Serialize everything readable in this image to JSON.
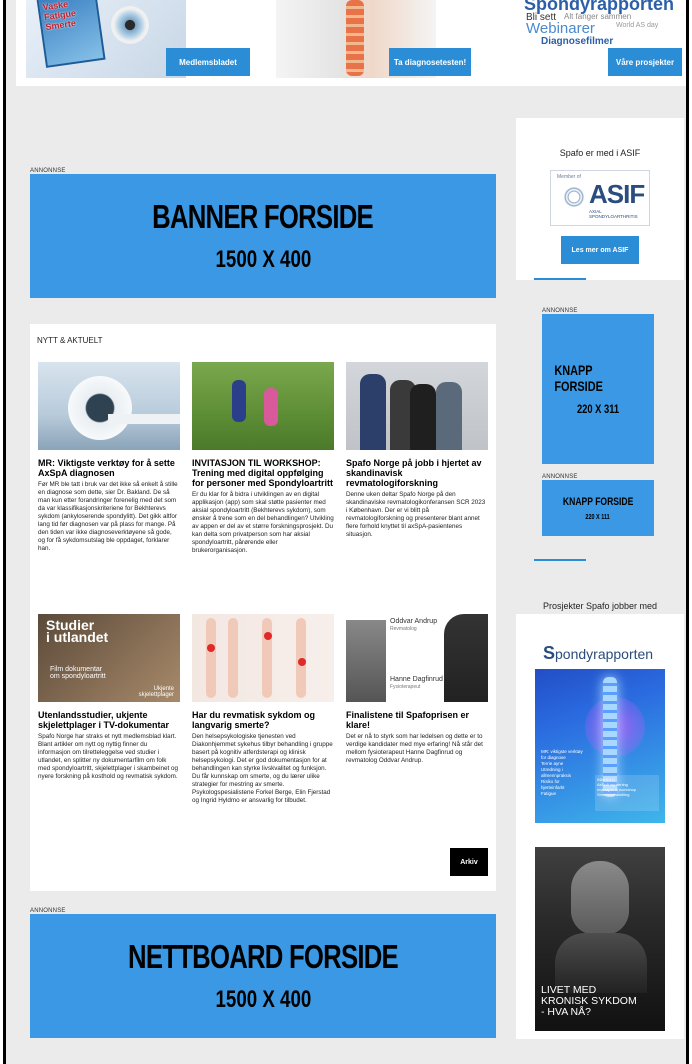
{
  "hero": {
    "book_text": "Vaske\nFatigue\nSmerte",
    "wordcloud": {
      "big": "Spondyrapporten",
      "w1": "Bli sett",
      "w2": "Alt fanger sammen",
      "w3": "Webinarer",
      "w4": "Diagnosefilmer",
      "w5": "World AS day"
    },
    "buttons": [
      "Medlemsbladet",
      "Ta diagnosetesten!",
      "Våre prosjekter"
    ]
  },
  "ads": {
    "label": "ANNONNSE",
    "banner_top": {
      "line1": "BANNER FORSIDE",
      "line2": "1500 X 400"
    },
    "banner_bottom": {
      "line1": "NETTBOARD FORSIDE",
      "line2": "1500 X 400"
    },
    "knapp1": {
      "line1": "KNAPP FORSIDE",
      "line2": "220 X 311"
    },
    "knapp2": {
      "line1": "KNAPP FORSIDE",
      "line2": "220 X 111"
    }
  },
  "news": {
    "section_title": "NYTT & AKTUELT",
    "archive_label": "Arkiv",
    "articles": [
      {
        "title": "MR: Viktigste verktøy for å sette AxSpA diagnosen",
        "body": "Før MR ble tatt i bruk var det ikke så enkelt å stille en diagnose som dette, sier Dr. Bakland. De så man kun etter forandringer forenelig med det som da var klassifikasjonskriteriene for Bekhterevs sykdom (ankyloserende spondylitt). Det gikk altfor lang tid før diagnosen var på plass for mange. På den tiden var ikke diagnoseverktøyene så gode, og for få sykdomsutslag ble oppdaget, forklarer han."
      },
      {
        "title": "INVITASJON TIL WORKSHOP: Trening med digital oppfølging for personer med Spondyloartritt",
        "body": "Er du klar for å bidra i utviklingen av en digital applikasjon (app) som skal støtte pasienter med aksial spondyloartritt (Bekhterevs sykdom), som ønsker å trene som en del behandlingen? Utvikling av appen er del av et større forskningsprosjekt. Du kan delta som privatperson som har aksial spondyloartritt, pårørende eller brukerorganisasjon."
      },
      {
        "title": "Spafo Norge på jobb i hjertet av skandinavisk revmatologiforskning",
        "body": "Denne uken deltar Spafo Norge på den skandinaviske revmatologikonferansen SCR 2023 i København. Der er vi blitt på revmatologiforskning og presenterer blant annet flere forhold knyttet til axSpA-pasientenes situasjon."
      },
      {
        "title": "Utenlandsstudier, ukjente skjelettplager i TV-dokumentar",
        "body": "Spafo Norge har straks et nytt medlemsblad klart. Blant artikler om nytt og nyttig finner du informasjon om tilretteleggelse ved studier i utlandet, en splitter ny dokumentarfilm om folk med spondyloartritt, skjelettplager i skambeinet og nyere forskning på kosthold og revmatisk sykdom."
      },
      {
        "title": "Har du revmatisk sykdom og langvarig smerte?",
        "body": "Den helsepsykologiske tjenesten ved Diakonhjemmet sykehus tilbyr behandling i gruppe basert på kognitiv atferdsterapi og klinisk helsepsykologi. Det er god dokumentasjon for at behandlingen kan styrke livskvalitet og funksjon. Du får kunnskap om smerte, og du lærer ulike strategier for mestring av smerte. Psykologspesialistene Forkel Berge, Elin Fjerstad og Ingrid Hyldmo er ansvarlig for tilbudet."
      },
      {
        "title": "Finalistene til Spafoprisen er klare!",
        "body": "Det er nå to styrk som har ledelsen og dette er to verdige kandidater med mye erfaring! Nå står det mellom fysioterapeut Hanne Dagfinrud og revmatolog Oddvar Andrup."
      }
    ],
    "thumb_texts": {
      "travel_main": "Studier\ni utlandet",
      "travel_sub": "Film dokumentar\nom spondyloartritt",
      "travel_side": "Ukjente\nskjelettplager",
      "jury_name1": "Oddvar Andrup",
      "jury_role1": "Revmatolog",
      "jury_name2": "Hanne Dagfinrud",
      "jury_role2": "Fysioterapeut"
    }
  },
  "sidebar": {
    "asif_title": "Spafo er med i ASIF",
    "asif_logo": {
      "member": "Member of",
      "word": "ASIF",
      "sub": "AXIAL SPONDYLOARTHRITIS"
    },
    "asif_button": "Les mer om ASIF",
    "projects_title": "Prosjekter Spafo jobber med",
    "cover1": {
      "brand_s": "S",
      "brand_rest": "pondyrapporten",
      "lines": "MR: viktigste verktøy\nfor diagnose\nTerrie ayne\nUtredning i\nallmennpraksis\nRisiko for\nhjerteinfarkt\nFatigue",
      "box": "INNHOLD\nAxSpA og trening\nInvitasjon til workshop\nSmertebehandling"
    },
    "cover2": {
      "text": "LIVET MED\nKRONISK SYKDOM\n- HVA NÅ?"
    }
  },
  "colors": {
    "accent": "#2b8dd6",
    "ad_blue": "#3a98e4",
    "page_bg": "#ebebeb"
  }
}
